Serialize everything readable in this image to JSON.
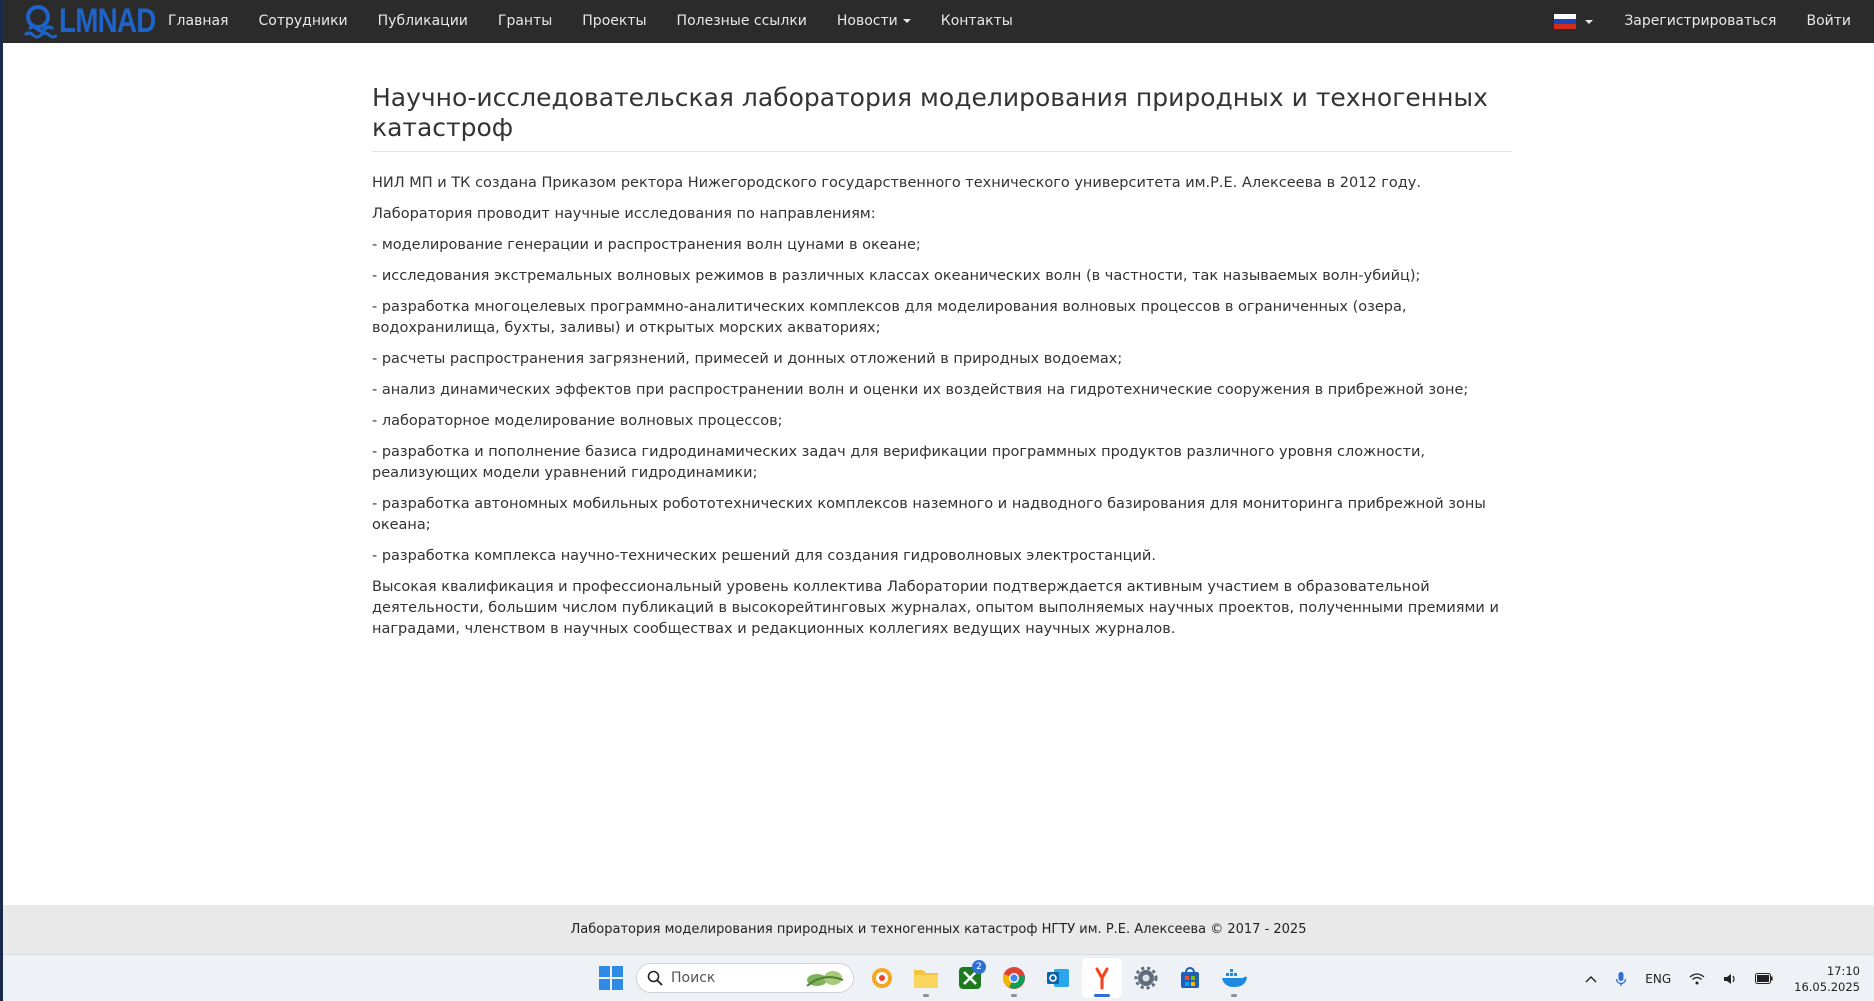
{
  "navbar": {
    "logo_text": "LMNAD",
    "items": [
      {
        "label": "Главная"
      },
      {
        "label": "Сотрудники"
      },
      {
        "label": "Публикации"
      },
      {
        "label": "Гранты"
      },
      {
        "label": "Проекты"
      },
      {
        "label": "Полезные ссылки"
      },
      {
        "label": "Новости",
        "dropdown": true
      },
      {
        "label": "Контакты"
      }
    ],
    "language_flag": "russia-flag-icon",
    "register_label": "Зарегистрироваться",
    "login_label": "Войти"
  },
  "main": {
    "title": "Научно-исследовательская лаборатория моделирования природных и техногенных катастроф",
    "paragraphs": [
      "НИЛ МП и ТК создана Приказом ректора Нижегородского государственного технического университета им.Р.Е. Алексеева в 2012 году.",
      "Лаборатория проводит научные исследования по направлениям:",
      "- моделирование генерации и распространения волн цунами в океане;",
      "- исследования экстремальных волновых режимов в различных классах океанических волн (в частности, так называемых волн-убийц);",
      "- разработка многоцелевых программно-аналитических комплексов для моделирования волновых процессов в ограниченных (озера, водохранилища, бухты, заливы) и открытых морских акваториях;",
      "- расчеты распространения загрязнений, примесей и донных отложений в природных водоемах;",
      "- анализ динамических эффектов при распространении волн и оценки их воздействия на гидротехнические сооружения в прибрежной зоне;",
      "- лабораторное моделирование волновых процессов;",
      "- разработка и пополнение базиса гидродинамических задач для верификации программных продуктов различного уровня сложности, реализующих модели уравнений гидродинамики;",
      "- разработка автономных мобильных робототехнических комплексов наземного и надводного базирования для мониторинга прибрежной зоны океана;",
      "- разработка комплекса научно-технических решений для создания гидроволновых электростанций.",
      "Высокая квалификация и профессиональный уровень коллектива Лаборатории подтверждается активным участием в образовательной деятельности, большим числом публикаций в высокорейтинговых журналах, опытом выполняемых научных проектов, полученными премиями и наградами, членством в научных сообществах и редакционных коллегиях ведущих научных журналов."
    ]
  },
  "footer": {
    "text": "Лаборатория моделирования природных и техногенных катастроф НГТУ им. Р.Е. Алексеева © 2017 - 2025"
  },
  "taskbar": {
    "search_placeholder": "Поиск",
    "apps": [
      {
        "icon": "music-app-icon"
      },
      {
        "icon": "file-explorer-icon"
      },
      {
        "icon": "xbox-icon",
        "badge": "2"
      },
      {
        "icon": "chrome-icon"
      },
      {
        "icon": "outlook-icon"
      },
      {
        "icon": "yandex-browser-icon",
        "active": true
      },
      {
        "icon": "settings-icon"
      },
      {
        "icon": "store-icon"
      },
      {
        "icon": "docker-icon"
      }
    ],
    "language": "ENG",
    "time": "17:10",
    "date": "16.05.2025"
  },
  "colors": {
    "navbar_bg": "#2b2b2b",
    "logo_blue": "#1e63c8",
    "footer_bg": "#e9e9e9",
    "taskbar_bg": "#eef1f5",
    "accent": "#2f6fd6"
  }
}
